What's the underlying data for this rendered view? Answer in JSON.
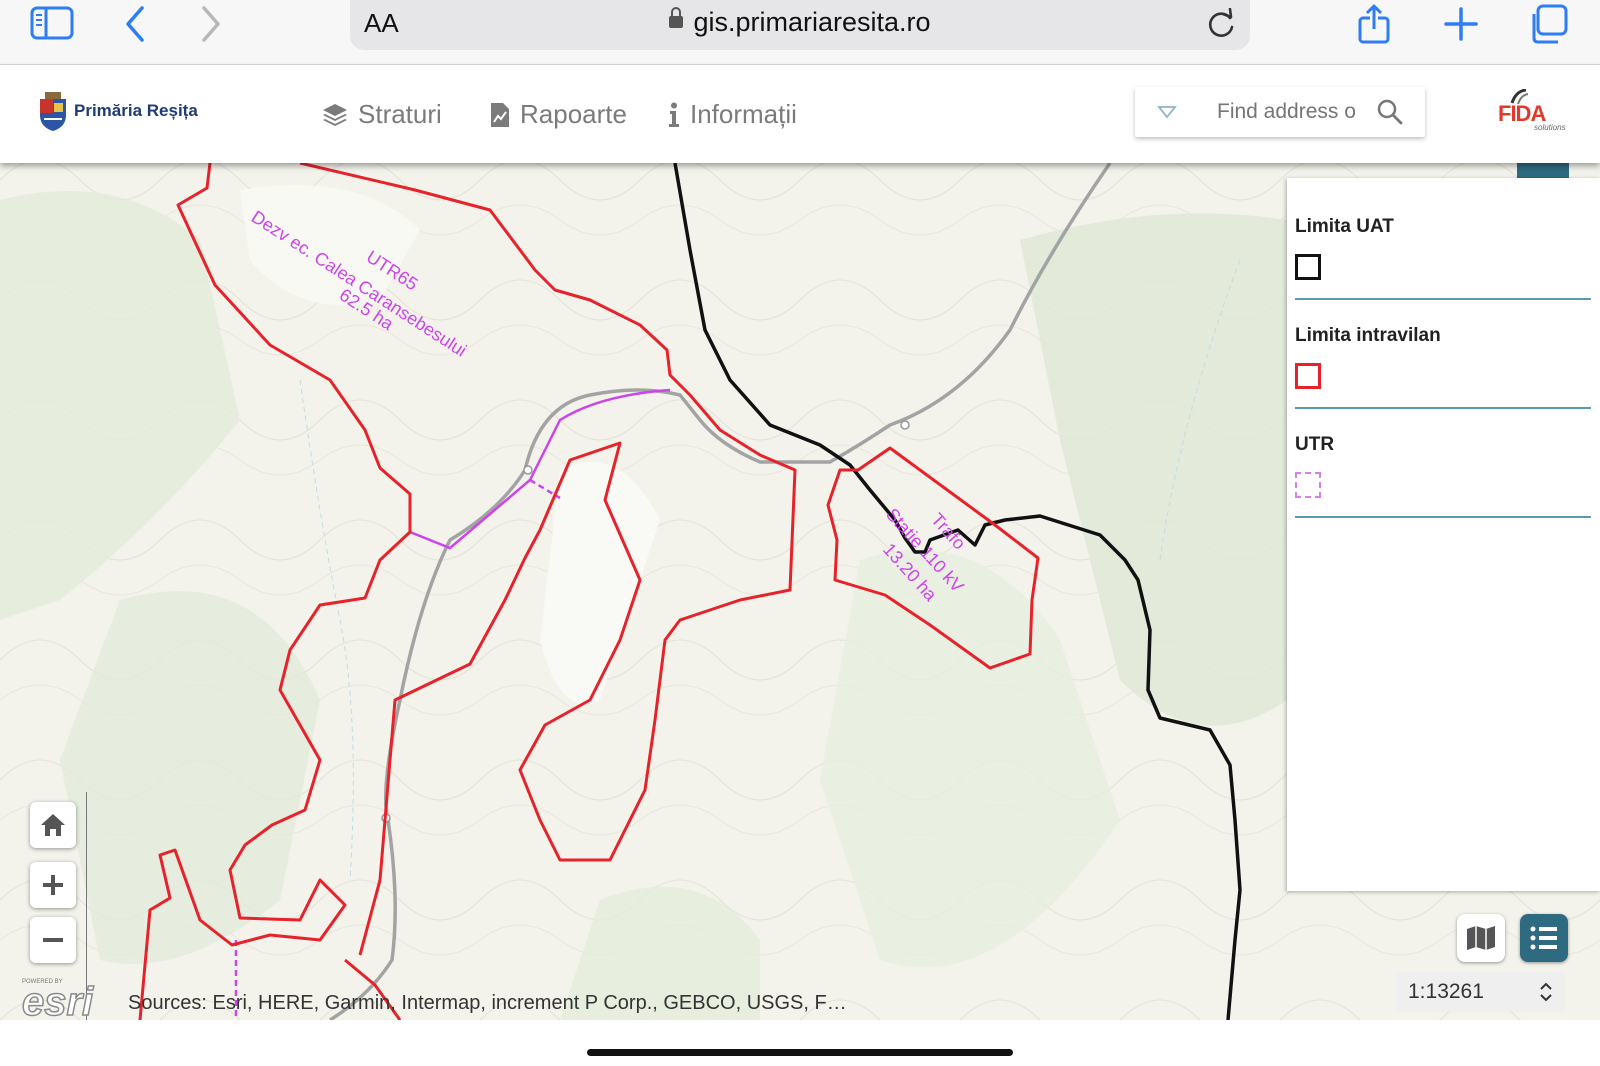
{
  "browser": {
    "text_size_label": "AA",
    "url": "gis.primariaresita.ro"
  },
  "header": {
    "logo_text": "Primăria Reșița",
    "nav": [
      {
        "label": "Straturi",
        "icon": "layers-icon"
      },
      {
        "label": "Rapoarte",
        "icon": "report-icon"
      },
      {
        "label": "Informații",
        "icon": "info-icon"
      }
    ],
    "search_placeholder": "Find address o",
    "partner_logo": "FIDA",
    "partner_logo_sub": "solutions"
  },
  "map": {
    "labels": {
      "utr65": [
        "UTR65",
        "Dezv ec. Calea Caransebesului",
        "62.5 ha"
      ],
      "trafo": [
        "Trafo",
        "Statie 110 kV",
        "13.20 ha"
      ]
    },
    "esri_logo": "esri",
    "esri_powered": "POWERED BY",
    "attribution": "Sources: Esri, HERE, Garmin, Intermap, increment P Corp., GEBCO, USGS, F…",
    "scale": "1:13261",
    "colors": {
      "intravilan": "#e8222a",
      "uat": "#111111",
      "utr": "#cc44ee",
      "road": "#9a9a9a",
      "legend_accent": "#5b9bb0",
      "active_button": "#2e6a80"
    }
  },
  "legend": {
    "items": [
      {
        "title": "Limita UAT",
        "swatch": "black-square-outline"
      },
      {
        "title": "Limita intravilan",
        "swatch": "red-square-outline"
      },
      {
        "title": "UTR",
        "swatch": "magenta-dashed-square"
      }
    ]
  }
}
